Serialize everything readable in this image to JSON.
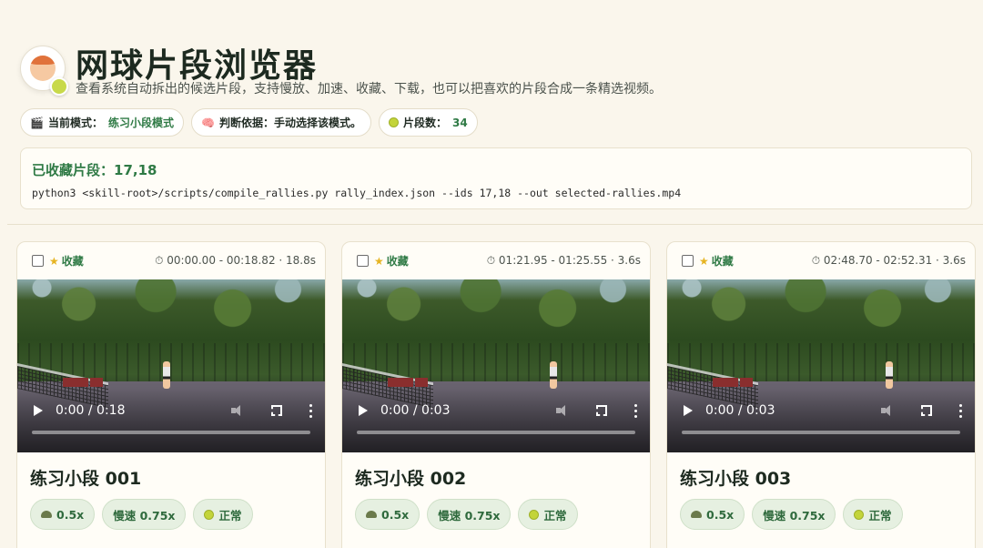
{
  "header": {
    "title": "网球片段浏览器",
    "subtitle": "查看系统自动拆出的候选片段，支持慢放、加速、收藏、下载，也可以把喜欢的片段合成一条精选视频。"
  },
  "pills": {
    "mode_label": "当前模式：",
    "mode_value": "练习小段模式",
    "basis_label": "判断依据：",
    "basis_value": "手动选择该模式。",
    "count_label": "片段数：",
    "count_value": "34"
  },
  "favorites": {
    "title": "已收藏片段：17,18",
    "command": "python3 <skill-root>/scripts/compile_rallies.py rally_index.json --ids 17,18 --out selected-rallies.mp4"
  },
  "clips": [
    {
      "fav_label": "收藏",
      "time_range": "00:00.00 - 00:18.82 · 18.8s",
      "player_time": "0:00 / 0:18",
      "progress": 0.0,
      "title": "练习小段 001",
      "speeds": [
        "0.5x",
        "慢速 0.75x",
        "正常"
      ]
    },
    {
      "fav_label": "收藏",
      "time_range": "01:21.95 - 01:25.55 · 3.6s",
      "player_time": "0:00 / 0:03",
      "progress": 0.0,
      "title": "练习小段 002",
      "speeds": [
        "0.5x",
        "慢速 0.75x",
        "正常"
      ]
    },
    {
      "fav_label": "收藏",
      "time_range": "02:48.70 - 02:52.31 · 3.6s",
      "player_time": "0:00 / 0:03",
      "progress": 0.0,
      "title": "练习小段 003",
      "speeds": [
        "0.5x",
        "慢速 0.75x",
        "正常"
      ]
    }
  ],
  "colors": {
    "accent": "#2f7a45",
    "background": "#faf6ec"
  }
}
